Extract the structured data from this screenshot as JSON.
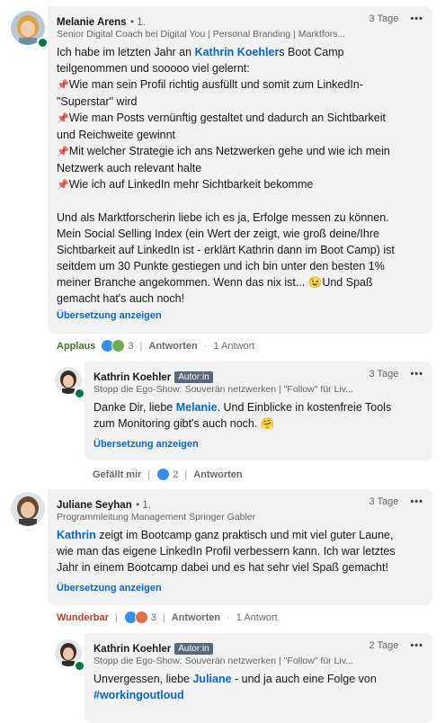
{
  "comments": [
    {
      "author": "Melanie Arens",
      "degree": "• 1.",
      "headline": "Senior Digital Coach bei Digital You | Personal Branding | Marktfors...",
      "time": "3 Tage",
      "more": "•••",
      "body": {
        "line1_pre": "Ich habe im letzten Jahr an ",
        "line1_mention": "Kathrin Koehler",
        "line1_post": "s Boot Camp",
        "line2": "teilgenommen und sooooo viel gelernt:",
        "pin": "📌",
        "bullets": [
          "Wie man sein Profil richtig ausfüllt und somit zum LinkedIn-",
          "\"Superstar\" wird",
          "Wie man Posts vernünftig gestaltet und dadurch an Sichtbarkeit",
          "und Reichweite gewinnt",
          "Mit welcher Strategie ich ans Netzwerken gehe und wie ich mein",
          "Netzwerk auch relevant halte",
          "Wie ich auf LinkedIn mehr Sichtbarkeit bekomme"
        ],
        "para2": [
          "Und als Marktforscherin liebe ich es ja, Erfolge messen zu können.",
          "Mein Social Selling Index (ein Wert der zeigt, wie groß deine/Ihre",
          "Sichtbarkeit auf LinkedIn ist - erklärt Kathrin dann im Boot Camp) ist",
          "seitdem um 30 Punkte gestiegen und ich bin unter den besten 1%",
          "meiner Branche angekommen. Wenn das nix ist... 😉Und Spaß",
          "gemacht hat's auch noch!"
        ]
      },
      "translate": "Übersetzung anzeigen",
      "reaction_label": "Applaus",
      "reaction_count": "3",
      "reply_label": "Antworten",
      "replies_count": "1 Antwort"
    },
    {
      "author": "Kathrin Koehler",
      "badge": "Autor:in",
      "headline": "Stopp die Ego-Show: Souverän netzwerken | \"Follow\" für Liv...",
      "time": "3 Tage",
      "more": "•••",
      "body": {
        "pre": "Danke Dir, liebe ",
        "mention": "Melanie",
        "post": ". Und Einblicke in kostenfreie Tools",
        "line2": "zum Monitoring gibt's auch noch. 🤗"
      },
      "translate": "Übersetzung anzeigen",
      "reaction_label": "Gefällt mir",
      "reaction_count": "2",
      "reply_label": "Antworten"
    },
    {
      "author": "Juliane Seyhan",
      "degree": "• 1.",
      "headline": "Programmleitung Management Springer Gabler",
      "time": "3 Tage",
      "more": "•••",
      "body": {
        "mention": "Kathrin",
        "line1_post": " zeigt im Bootcamp ganz praktisch und mit viel guter Laune,",
        "line2": "wie man das eigene LinkedIn Profil verbessern kann. Ich war letztes",
        "line3": "Jahr in einem Bootcamp dabei und es hat sehr viel Spaß gemacht!"
      },
      "translate": "Übersetzung anzeigen",
      "reaction_label": "Wunderbar",
      "reaction_count": "3",
      "reply_label": "Antworten",
      "replies_count": "1 Antwort"
    },
    {
      "author": "Kathrin Koehler",
      "badge": "Autor:in",
      "headline": "Stopp die Ego-Show: Souverän netzwerken | \"Follow\" für Liv...",
      "time": "2 Tage",
      "more": "•••",
      "body": {
        "pre": "Unvergessen, liebe ",
        "mention": "Juliane",
        "post": " - und ja auch eine Folge von",
        "hashtag": "#workingoutloud"
      }
    }
  ],
  "colors": {
    "link": "#0a66c2",
    "applaus": "#44712e",
    "wunderbar": "#b24020",
    "bubble": "#f2f2f2",
    "online": "#057642"
  }
}
